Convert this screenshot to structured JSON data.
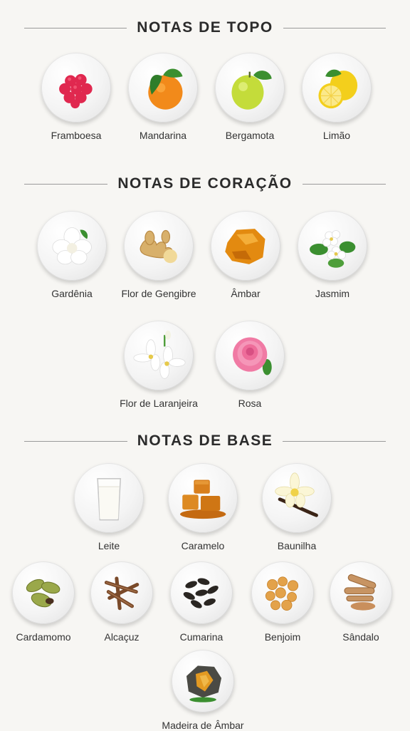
{
  "sections": {
    "top": {
      "title": "NOTAS DE TOPO",
      "notes": [
        {
          "label": "Framboesa",
          "icon": "raspberry-icon"
        },
        {
          "label": "Mandarina",
          "icon": "mandarin-icon"
        },
        {
          "label": "Bergamota",
          "icon": "bergamot-icon"
        },
        {
          "label": "Limão",
          "icon": "lemon-icon"
        }
      ]
    },
    "heart": {
      "title": "NOTAS DE CORAÇÃO",
      "notes": [
        {
          "label": "Gardênia",
          "icon": "gardenia-icon"
        },
        {
          "label": "Flor de Gengibre",
          "icon": "ginger-icon"
        },
        {
          "label": "Âmbar",
          "icon": "amber-icon"
        },
        {
          "label": "Jasmim",
          "icon": "jasmine-icon"
        },
        {
          "label": "Flor de Laranjeira",
          "icon": "orange-blossom-icon"
        },
        {
          "label": "Rosa",
          "icon": "rose-icon"
        }
      ]
    },
    "base": {
      "title": "NOTAS DE BASE",
      "notes": [
        {
          "label": "Leite",
          "icon": "milk-icon"
        },
        {
          "label": "Caramelo",
          "icon": "caramel-icon"
        },
        {
          "label": "Baunilha",
          "icon": "vanilla-icon"
        },
        {
          "label": "Cardamomo",
          "icon": "cardamom-icon"
        },
        {
          "label": "Alcaçuz",
          "icon": "licorice-icon"
        },
        {
          "label": "Cumarina",
          "icon": "tonka-bean-icon"
        },
        {
          "label": "Benjoim",
          "icon": "benzoin-icon"
        },
        {
          "label": "Sândalo",
          "icon": "sandalwood-icon"
        },
        {
          "label": "Madeira de Âmbar",
          "icon": "amber-wood-icon"
        }
      ]
    }
  }
}
